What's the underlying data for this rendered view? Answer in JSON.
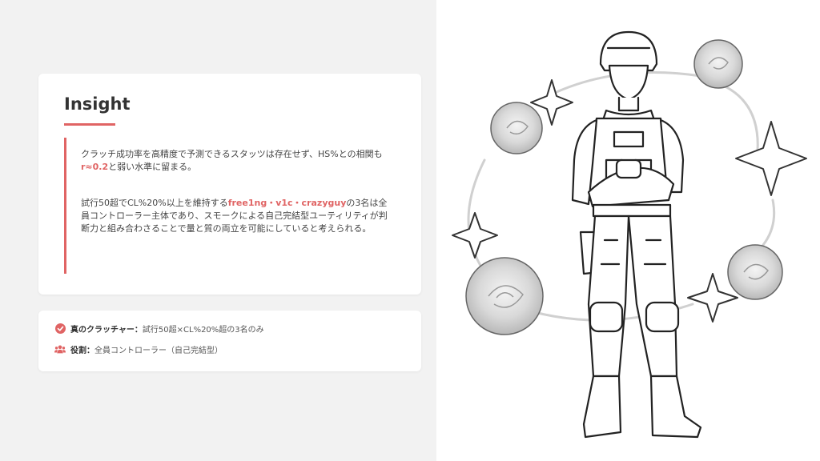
{
  "insight": {
    "title": "Insight",
    "p1_a": "クラッチ成功率を高精度で予測できるスタッツは存在せず、HS%との相関も",
    "p1_hl": "r≈0.2",
    "p1_b": "と弱い水準に留まる。",
    "p2_a": "試行50超でCL%20%以上を維持する",
    "p2_hl": "free1ng・v1c・crazyguy",
    "p2_b": "の3名は全員コントローラー主体であり、スモークによる自己完結型ユーティリティが判断力と組み合わさることで量と質の両立を可能にしていると考えられる。"
  },
  "summary": {
    "row1_label": "真のクラッチャー：",
    "row1_value": "試行50超×CL%20%超の3名のみ",
    "row2_label": "役割：",
    "row2_value": "全員コントローラー（自己完結型）"
  },
  "colors": {
    "accent": "#e06464",
    "background": "#f2f2f2",
    "card": "#ffffff"
  },
  "icons": {
    "row1": "check-circle-icon",
    "row2": "users-icon"
  }
}
